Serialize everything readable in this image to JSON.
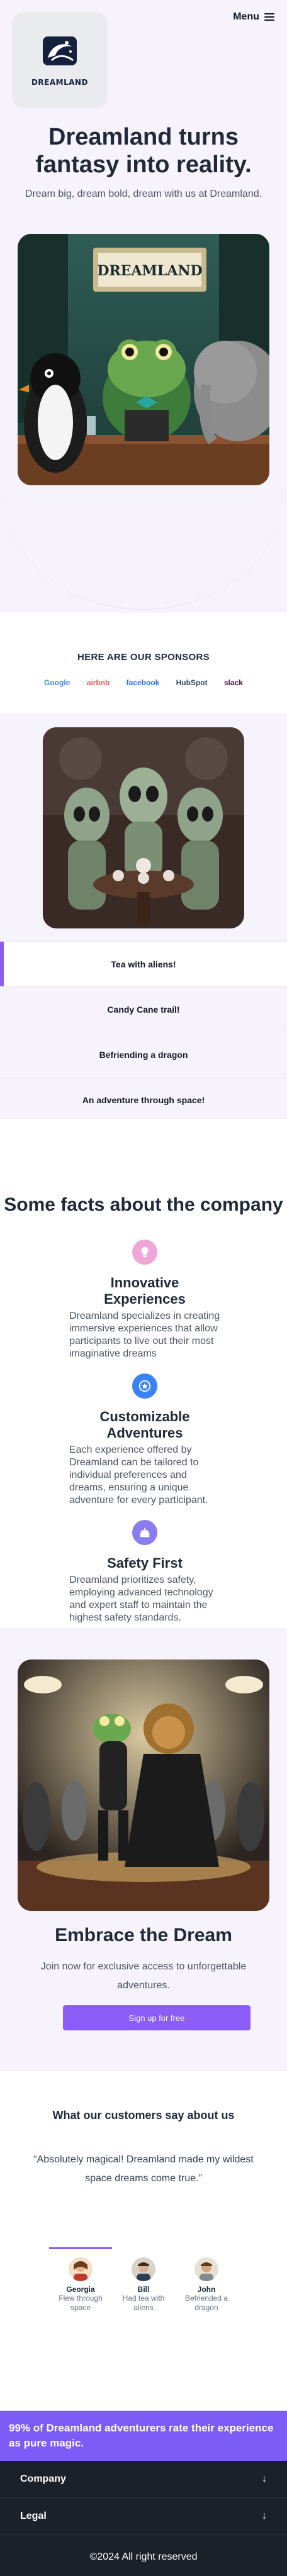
{
  "header": {
    "logo_text": "DREAMLAND",
    "menu_label": "Menu"
  },
  "hero": {
    "title": "Dreamland turns fantasy into reality.",
    "subtitle": "Dream big, dream bold, dream with us at Dreamland.",
    "image_sign": "DREAMLAND"
  },
  "sponsors": {
    "title": "HERE ARE OUR SPONSORS",
    "items": [
      "Google",
      "airbnb",
      "facebook",
      "HubSpot",
      "slack"
    ]
  },
  "tabs": {
    "items": [
      {
        "label": "Tea with aliens!"
      },
      {
        "label": "Candy Cane trail!"
      },
      {
        "label": "Befriending a dragon"
      },
      {
        "label": "An adventure through space!"
      }
    ],
    "active_index": 0
  },
  "facts": {
    "title": "Some facts about the company",
    "items": [
      {
        "icon": "lightbulb-icon",
        "title": "Innovative Experiences",
        "text": "Dreamland specializes in creating immersive experiences that allow participants to live out their most imaginative dreams"
      },
      {
        "icon": "star-badge-icon",
        "title": "Customizable Adventures",
        "text": "Each experience offered by Dreamland can be tailored to individual preferences and dreams, ensuring a unique adventure for every participant."
      },
      {
        "icon": "cake-icon",
        "title": "Safety First",
        "text": "Dreamland prioritizes safety, employing advanced technology and expert staff to maintain the highest safety standards."
      }
    ]
  },
  "embrace": {
    "title": "Embrace the Dream",
    "text": "Join now for exclusive access to unforgettable adventures.",
    "button_label": "Sign up for free"
  },
  "testimonials": {
    "title": "What our customers say about us",
    "quote": "“Absolutely magical! Dreamland made my wildest space dreams come true.”",
    "people": [
      {
        "name": "Georgia",
        "role": "Flew through space"
      },
      {
        "name": "Bill",
        "role": "Had tea with aliens"
      },
      {
        "name": "John",
        "role": "Befriended a dragon"
      }
    ],
    "active_index": 0
  },
  "stat": {
    "text": "99% of Dreamland adventurers rate their experience as pure magic."
  },
  "footer": {
    "sections": [
      "Company",
      "Legal"
    ],
    "copyright": "©2024 All right reserved"
  },
  "colors": {
    "accent": "#8b5cf6",
    "stat_bg": "#7c5cf6",
    "section_bg": "#f6f3fd",
    "footer_bg": "#1c2029"
  }
}
